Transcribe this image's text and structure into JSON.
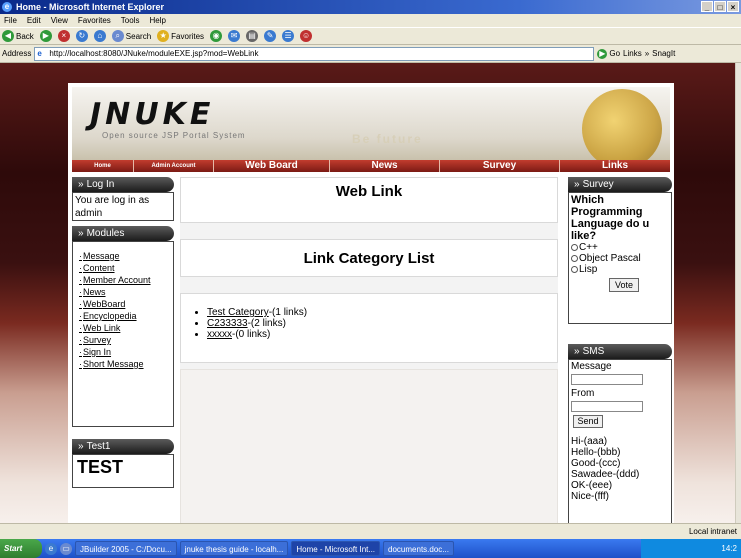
{
  "browser": {
    "title": "Home - Microsoft Internet Explorer",
    "menu": [
      "File",
      "Edit",
      "View",
      "Favorites",
      "Tools",
      "Help"
    ],
    "toolbar": {
      "back": "Back",
      "search": "Search",
      "favorites": "Favorites"
    },
    "address": {
      "label": "Address",
      "url": "http://localhost:8080/JNuke/moduleEXE.jsp?mod=WebLink",
      "go": "Go",
      "links": "Links",
      "snagit": "SnagIt"
    }
  },
  "site": {
    "logo": "JNUKE",
    "tagline": "Open source JSP Portal System",
    "watermark": "Be future",
    "nav": [
      "Home",
      "Admin Account",
      "Web Board",
      "News",
      "Survey",
      "Links"
    ]
  },
  "login": {
    "title": "Log In",
    "text": "You are log in as admin"
  },
  "modules": {
    "title": "Modules",
    "items": [
      "Message",
      "Content",
      "Member Account",
      "News",
      "WebBoard",
      "Encyclopedia",
      "Web Link",
      "Survey",
      "Sign In",
      "Short Message"
    ]
  },
  "test_panel": {
    "title": "Test1",
    "text": "TEST"
  },
  "main": {
    "title": "Web Link",
    "list_title": "Link Category List",
    "categories": [
      {
        "name": "Test Category",
        "count": "-(1 links)"
      },
      {
        "name": "C233333",
        "count": "-(2 links)"
      },
      {
        "name": "xxxxx",
        "count": "-(0 links)"
      }
    ]
  },
  "survey": {
    "title": "Survey",
    "question": "Which Programming Language do u like?",
    "options": [
      "C++",
      "Object Pascal",
      "Lisp"
    ],
    "vote": "Vote"
  },
  "sms": {
    "title": "SMS",
    "message_label": "Message",
    "from_label": "From",
    "send": "Send",
    "messages": [
      "Hi-(aaa)",
      "Hello-(bbb)",
      "Good-(ccc)",
      "Sawadee-(ddd)",
      "OK-(eee)",
      "Nice-(fff)"
    ]
  },
  "status": {
    "zone": "Local intranet"
  },
  "taskbar": {
    "start": "Start",
    "tasks": [
      "JBuilder 2005 - C:/Docu...",
      "jnuke thesis guide - localh...",
      "Home - Microsoft Int...",
      "documents.doc..."
    ],
    "clock": "14:2"
  }
}
